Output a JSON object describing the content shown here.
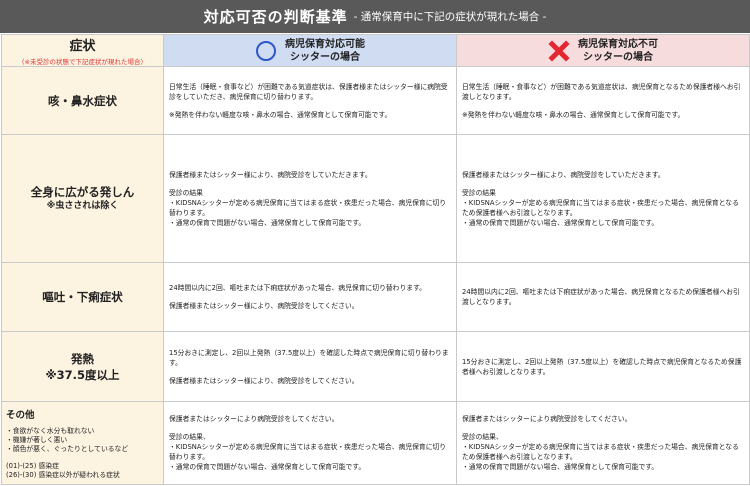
{
  "title": {
    "main": "対応可否の判断基準",
    "sub": "- 通常保育中に下記の症状が現れた場合 -"
  },
  "header": {
    "symptom_title": "症状",
    "symptom_note": "（※未受診の状態で下記症状が現れた場合）",
    "ok_label_line1": "病児保育対応可能",
    "ok_label_line2": "シッターの場合",
    "ng_label_line1": "病児保育対応不可",
    "ng_label_line2": "シッターの場合",
    "ok_icon": "circle-icon",
    "ng_icon": "cross-icon",
    "ok_color": "#2f56c8",
    "ng_color": "#e3262f"
  },
  "rows": [
    {
      "symptom": "咳・鼻水症状",
      "symptom_sub": "",
      "ok": [
        "日常生活（睡眠・食事など）が困難である気道症状は、保護者様またはシッター様に病院受診をしていただき、病児保育に切り替わります。",
        "※発熱を伴わない軽度な咳・鼻水の場合、通常保育として保育可能です。"
      ],
      "ng": [
        "日常生活（睡眠・食事など）が困難である気道症状は、病児保育となるため保護者様へお引渡しとなります。",
        "※発熱を伴わない軽度な咳・鼻水の場合、通常保育として保育可能です。"
      ]
    },
    {
      "symptom": "全身に広がる発しん",
      "symptom_sub": "※虫さされは除く",
      "ok": [
        "保護者様またはシッター様により、病院受診をしていただきます。",
        "受診の結果\n・KIDSNAシッターが定める病児保育に当てはまる症状・疾患だった場合、病児保育に切り替わります。\n・通常の保育で問題がない場合、通常保育として保育可能です。"
      ],
      "ng": [
        "保護者様またはシッター様により、病院受診をしていただきます。",
        "受診の結果\n・KIDSNAシッターが定める病児保育に当てはまる症状・疾患だった場合、病児保育となるため保護者様へお引渡しとなります。\n・通常の保育で問題がない場合、通常保育として保育可能です。"
      ]
    },
    {
      "symptom": "嘔吐・下痢症状",
      "symptom_sub": "",
      "ok": [
        "24時間以内に2回、嘔吐または下痢症状があった場合、病児保育に切り替わります。",
        "保護者様またはシッター様により、病院受診をしてください。"
      ],
      "ng": [
        "24時間以内に2回、嘔吐または下痢症状があった場合、病児保育となるため保護者様へお引渡しとなります。"
      ]
    },
    {
      "symptom": "発熱",
      "symptom_sub": "※37.5度以上",
      "ok": [
        "15分おきに測定し、2回以上発熱（37.5度以上）を確認した時点で病児保育に切り替わります。",
        "保護者様またはシッター様により、病院受診をしてください。"
      ],
      "ng": [
        "15分おきに測定し、2回以上発熱（37.5度以上）を確認した時点で病児保育となるため保護者様へお引渡しとなります。"
      ]
    }
  ],
  "other": {
    "title": "その他",
    "items": [
      "・食欲がなく水分も取れない",
      "・機嫌が著しく悪い",
      "・顔色が悪く、ぐったりとしているなど"
    ],
    "notes": [
      "(01)-(25) 感染症",
      "(26)-(30) 感染症以外が疑われる症状"
    ],
    "ok": [
      "保護者またはシッターにより病院受診をしてください。",
      "受診の結果、\n・KIDSNAシッターが定める病児保育に当てはまる症状・疾患だった場合、病児保育に切り替わります。\n・通常の保育で問題がない場合、通常保育として保育可能です。"
    ],
    "ng": [
      "保護者またはシッターにより病院受診をしてください。",
      "受診の結果、\n・KIDSNAシッターが定める病児保育に当てはまる症状・疾患だった場合、病児保育となるため保護者様へお引渡しとなります。\n・通常の保育で問題がない場合、通常保育として保育可能です。"
    ]
  }
}
